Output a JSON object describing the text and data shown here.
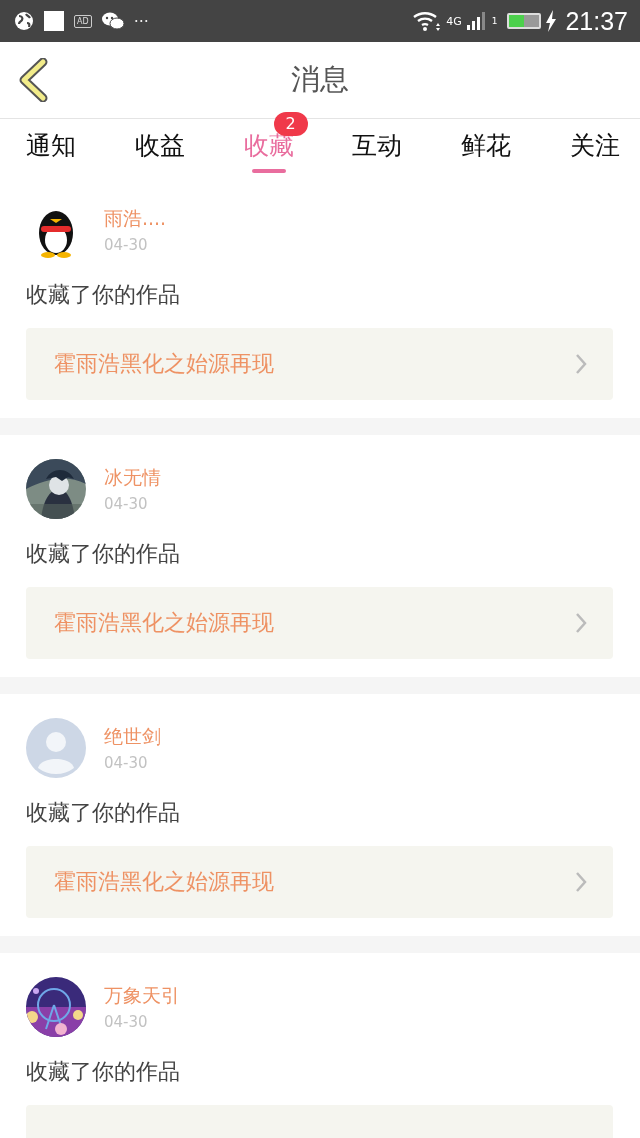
{
  "status_bar": {
    "ad_label": "AD",
    "more": "···",
    "network": "4G",
    "sim": "1",
    "time": "21:37"
  },
  "header": {
    "title": "消息"
  },
  "tabs": [
    {
      "label": "通知",
      "selected": false
    },
    {
      "label": "收益",
      "selected": false
    },
    {
      "label": "收藏",
      "selected": true,
      "badge": "2"
    },
    {
      "label": "互动",
      "selected": false
    },
    {
      "label": "鲜花",
      "selected": false
    },
    {
      "label": "关注",
      "selected": false
    }
  ],
  "messages": [
    {
      "kind": "penguin",
      "name": "雨浩....",
      "date": "04-30",
      "text": "收藏了你的作品",
      "work_title": "霍雨浩黑化之始源再现"
    },
    {
      "kind": "picture",
      "name": "冰无情",
      "date": "04-30",
      "text": "收藏了你的作品",
      "work_title": "霍雨浩黑化之始源再现"
    },
    {
      "kind": "default",
      "name": "绝世剑",
      "date": "04-30",
      "text": "收藏了你的作品",
      "work_title": "霍雨浩黑化之始源再现"
    },
    {
      "kind": "picture2",
      "name": "万象天引",
      "date": "04-30",
      "text": "收藏了你的作品"
    }
  ]
}
